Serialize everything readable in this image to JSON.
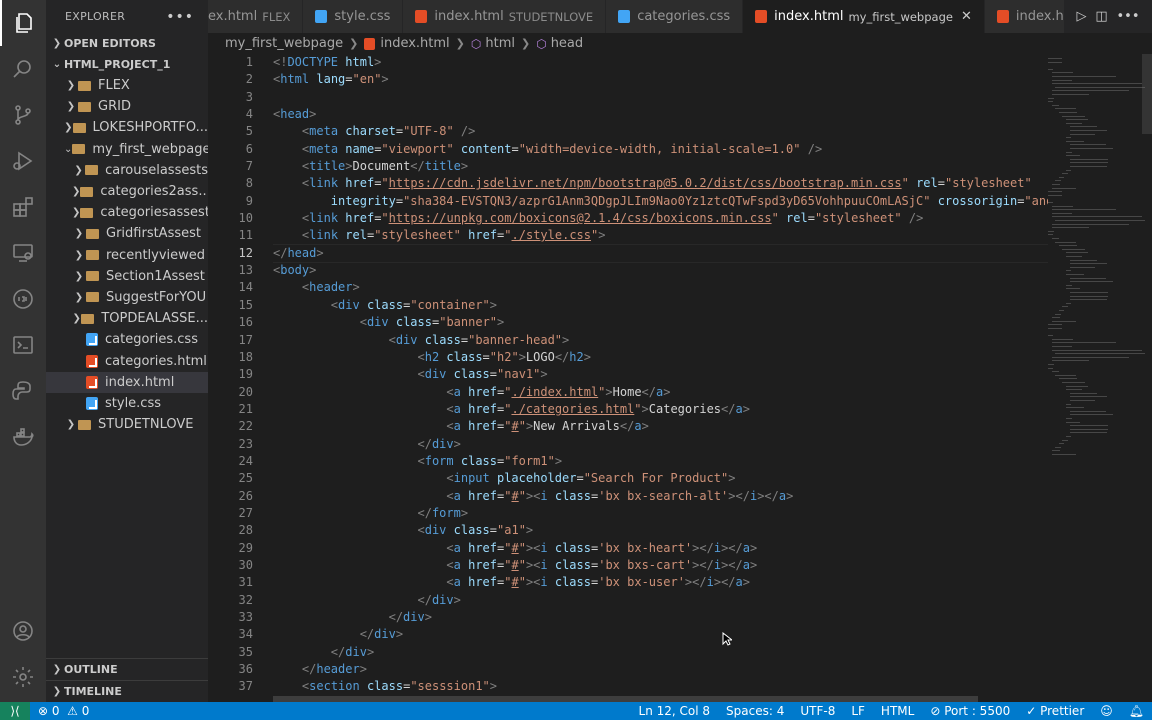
{
  "activity_bar": {
    "items": [
      {
        "name": "explorer-icon",
        "active": true
      },
      {
        "name": "search-icon"
      },
      {
        "name": "source-control-icon"
      },
      {
        "name": "run-debug-icon"
      },
      {
        "name": "extensions-icon"
      },
      {
        "name": "remote-explorer-icon"
      },
      {
        "name": "json-icon",
        "label": "Json"
      },
      {
        "name": "terminal-icon"
      },
      {
        "name": "python-icon"
      },
      {
        "name": "docker-icon"
      }
    ],
    "bottom": [
      {
        "name": "account-icon"
      },
      {
        "name": "settings-gear-icon"
      }
    ]
  },
  "sidebar": {
    "title": "EXPLORER",
    "more": "•••",
    "open_editors": "OPEN EDITORS",
    "project": "HTML_PROJECT_1",
    "tree": [
      {
        "label": "FLEX",
        "kind": "folder",
        "depth": 1
      },
      {
        "label": "GRID",
        "kind": "folder",
        "depth": 1
      },
      {
        "label": "LOKESHPORTFO...",
        "kind": "folder",
        "depth": 1
      },
      {
        "label": "my_first_webpage",
        "kind": "folder-open",
        "depth": 1
      },
      {
        "label": "carouselassests",
        "kind": "folder",
        "depth": 2
      },
      {
        "label": "categories2ass...",
        "kind": "folder",
        "depth": 2
      },
      {
        "label": "categoriesassest",
        "kind": "folder",
        "depth": 2
      },
      {
        "label": "GridfirstAssest",
        "kind": "folder",
        "depth": 2
      },
      {
        "label": "recentlyviewed",
        "kind": "folder",
        "depth": 2
      },
      {
        "label": "Section1Assest",
        "kind": "folder",
        "depth": 2
      },
      {
        "label": "SuggestForYOU",
        "kind": "folder",
        "depth": 2
      },
      {
        "label": "TOPDEALASSE...",
        "kind": "folder",
        "depth": 2
      },
      {
        "label": "categories.css",
        "kind": "css",
        "depth": 2
      },
      {
        "label": "categories.html",
        "kind": "html",
        "depth": 2
      },
      {
        "label": "index.html",
        "kind": "html",
        "depth": 2,
        "selected": true
      },
      {
        "label": "style.css",
        "kind": "css",
        "depth": 2
      },
      {
        "label": "STUDETNLOVE",
        "kind": "folder",
        "depth": 1
      }
    ],
    "outline": "OUTLINE",
    "timeline": "TIMELINE"
  },
  "tabs": [
    {
      "label": "ex.html",
      "desc": "FLEX",
      "kind": "none"
    },
    {
      "label": "style.css",
      "desc": "",
      "kind": "css"
    },
    {
      "label": "index.html",
      "desc": "STUDETNLOVE",
      "kind": "html"
    },
    {
      "label": "categories.css",
      "desc": "",
      "kind": "css"
    },
    {
      "label": "index.html",
      "desc": "my_first_webpage",
      "kind": "html",
      "active": true
    },
    {
      "label": "index.h",
      "desc": "",
      "kind": "html"
    }
  ],
  "tab_close": "✕",
  "breadcrumb": [
    "my_first_webpage",
    "index.html",
    "html",
    "head"
  ],
  "code_lines": [
    [
      [
        "pun",
        "<!"
      ],
      [
        "tag",
        "DOCTYPE"
      ],
      [
        "txt",
        " "
      ],
      [
        "attr",
        "html"
      ],
      [
        "pun",
        ">"
      ]
    ],
    [
      [
        "pun",
        "<"
      ],
      [
        "tag",
        "html"
      ],
      [
        "txt",
        " "
      ],
      [
        "attr",
        "lang"
      ],
      [
        "txt",
        "="
      ],
      [
        "str",
        "\"en\""
      ],
      [
        "pun",
        ">"
      ]
    ],
    [],
    [
      [
        "pun",
        "<"
      ],
      [
        "tag",
        "head"
      ],
      [
        "pun",
        ">"
      ]
    ],
    [
      [
        "txt",
        "    "
      ],
      [
        "pun",
        "<"
      ],
      [
        "tag",
        "meta"
      ],
      [
        "txt",
        " "
      ],
      [
        "attr",
        "charset"
      ],
      [
        "txt",
        "="
      ],
      [
        "str",
        "\"UTF-8\""
      ],
      [
        "txt",
        " "
      ],
      [
        "pun",
        "/>"
      ]
    ],
    [
      [
        "txt",
        "    "
      ],
      [
        "pun",
        "<"
      ],
      [
        "tag",
        "meta"
      ],
      [
        "txt",
        " "
      ],
      [
        "attr",
        "name"
      ],
      [
        "txt",
        "="
      ],
      [
        "str",
        "\"viewport\""
      ],
      [
        "txt",
        " "
      ],
      [
        "attr",
        "content"
      ],
      [
        "txt",
        "="
      ],
      [
        "str",
        "\"width=device-width, initial-scale=1.0\""
      ],
      [
        "txt",
        " "
      ],
      [
        "pun",
        "/>"
      ]
    ],
    [
      [
        "txt",
        "    "
      ],
      [
        "pun",
        "<"
      ],
      [
        "tag",
        "title"
      ],
      [
        "pun",
        ">"
      ],
      [
        "txt",
        "Document"
      ],
      [
        "pun",
        "</"
      ],
      [
        "tag",
        "title"
      ],
      [
        "pun",
        ">"
      ]
    ],
    [
      [
        "txt",
        "    "
      ],
      [
        "pun",
        "<"
      ],
      [
        "tag",
        "link"
      ],
      [
        "txt",
        " "
      ],
      [
        "attr",
        "href"
      ],
      [
        "txt",
        "="
      ],
      [
        "str",
        "\""
      ],
      [
        "link",
        "https://cdn.jsdelivr.net/npm/bootstrap@5.0.2/dist/css/bootstrap.min.css"
      ],
      [
        "str",
        "\""
      ],
      [
        "txt",
        " "
      ],
      [
        "attr",
        "rel"
      ],
      [
        "txt",
        "="
      ],
      [
        "str",
        "\"stylesheet\""
      ]
    ],
    [
      [
        "txt",
        "        "
      ],
      [
        "attr",
        "integrity"
      ],
      [
        "txt",
        "="
      ],
      [
        "str",
        "\"sha384-EVSTQN3/azprG1Anm3QDgpJLIm9Nao0Yz1ztcQTwFspd3yD65VohhpuuCOmLASjC\""
      ],
      [
        "txt",
        " "
      ],
      [
        "attr",
        "crossorigin"
      ],
      [
        "txt",
        "="
      ],
      [
        "str",
        "\"anonym"
      ]
    ],
    [
      [
        "txt",
        "    "
      ],
      [
        "pun",
        "<"
      ],
      [
        "tag",
        "link"
      ],
      [
        "txt",
        " "
      ],
      [
        "attr",
        "href"
      ],
      [
        "txt",
        "="
      ],
      [
        "str",
        "\""
      ],
      [
        "link",
        "https://unpkg.com/boxicons@2.1.4/css/boxicons.min.css"
      ],
      [
        "str",
        "\""
      ],
      [
        "txt",
        " "
      ],
      [
        "attr",
        "rel"
      ],
      [
        "txt",
        "="
      ],
      [
        "str",
        "\"stylesheet\""
      ],
      [
        "txt",
        " "
      ],
      [
        "pun",
        "/>"
      ]
    ],
    [
      [
        "txt",
        "    "
      ],
      [
        "pun",
        "<"
      ],
      [
        "tag",
        "link"
      ],
      [
        "txt",
        " "
      ],
      [
        "attr",
        "rel"
      ],
      [
        "txt",
        "="
      ],
      [
        "str",
        "\"stylesheet\""
      ],
      [
        "txt",
        " "
      ],
      [
        "attr",
        "href"
      ],
      [
        "txt",
        "="
      ],
      [
        "str",
        "\""
      ],
      [
        "link",
        "./style.css"
      ],
      [
        "str",
        "\""
      ],
      [
        "pun",
        ">"
      ]
    ],
    [
      [
        "pun",
        "</"
      ],
      [
        "tag",
        "head"
      ],
      [
        "pun",
        ">"
      ]
    ],
    [
      [
        "pun",
        "<"
      ],
      [
        "tag",
        "body"
      ],
      [
        "pun",
        ">"
      ]
    ],
    [
      [
        "txt",
        "    "
      ],
      [
        "pun",
        "<"
      ],
      [
        "tag",
        "header"
      ],
      [
        "pun",
        ">"
      ]
    ],
    [
      [
        "txt",
        "        "
      ],
      [
        "pun",
        "<"
      ],
      [
        "tag",
        "div"
      ],
      [
        "txt",
        " "
      ],
      [
        "attr",
        "class"
      ],
      [
        "txt",
        "="
      ],
      [
        "str",
        "\"container\""
      ],
      [
        "pun",
        ">"
      ]
    ],
    [
      [
        "txt",
        "            "
      ],
      [
        "pun",
        "<"
      ],
      [
        "tag",
        "div"
      ],
      [
        "txt",
        " "
      ],
      [
        "attr",
        "class"
      ],
      [
        "txt",
        "="
      ],
      [
        "str",
        "\"banner\""
      ],
      [
        "pun",
        ">"
      ]
    ],
    [
      [
        "txt",
        "                "
      ],
      [
        "pun",
        "<"
      ],
      [
        "tag",
        "div"
      ],
      [
        "txt",
        " "
      ],
      [
        "attr",
        "class"
      ],
      [
        "txt",
        "="
      ],
      [
        "str",
        "\"banner-head\""
      ],
      [
        "pun",
        ">"
      ]
    ],
    [
      [
        "txt",
        "                    "
      ],
      [
        "pun",
        "<"
      ],
      [
        "tag",
        "h2"
      ],
      [
        "txt",
        " "
      ],
      [
        "attr",
        "class"
      ],
      [
        "txt",
        "="
      ],
      [
        "str",
        "\"h2\""
      ],
      [
        "pun",
        ">"
      ],
      [
        "txt",
        "LOGO"
      ],
      [
        "pun",
        "</"
      ],
      [
        "tag",
        "h2"
      ],
      [
        "pun",
        ">"
      ]
    ],
    [
      [
        "txt",
        "                    "
      ],
      [
        "pun",
        "<"
      ],
      [
        "tag",
        "div"
      ],
      [
        "txt",
        " "
      ],
      [
        "attr",
        "class"
      ],
      [
        "txt",
        "="
      ],
      [
        "str",
        "\"nav1\""
      ],
      [
        "pun",
        ">"
      ]
    ],
    [
      [
        "txt",
        "                        "
      ],
      [
        "pun",
        "<"
      ],
      [
        "tag",
        "a"
      ],
      [
        "txt",
        " "
      ],
      [
        "attr",
        "href"
      ],
      [
        "txt",
        "="
      ],
      [
        "str",
        "\""
      ],
      [
        "link",
        "./index.html"
      ],
      [
        "str",
        "\""
      ],
      [
        "pun",
        ">"
      ],
      [
        "txt",
        "Home"
      ],
      [
        "pun",
        "</"
      ],
      [
        "tag",
        "a"
      ],
      [
        "pun",
        ">"
      ]
    ],
    [
      [
        "txt",
        "                        "
      ],
      [
        "pun",
        "<"
      ],
      [
        "tag",
        "a"
      ],
      [
        "txt",
        " "
      ],
      [
        "attr",
        "href"
      ],
      [
        "txt",
        "="
      ],
      [
        "str",
        "\""
      ],
      [
        "link",
        "./categories.html"
      ],
      [
        "str",
        "\""
      ],
      [
        "pun",
        ">"
      ],
      [
        "txt",
        "Categories"
      ],
      [
        "pun",
        "</"
      ],
      [
        "tag",
        "a"
      ],
      [
        "pun",
        ">"
      ]
    ],
    [
      [
        "txt",
        "                        "
      ],
      [
        "pun",
        "<"
      ],
      [
        "tag",
        "a"
      ],
      [
        "txt",
        " "
      ],
      [
        "attr",
        "href"
      ],
      [
        "txt",
        "="
      ],
      [
        "str",
        "\""
      ],
      [
        "link",
        "#"
      ],
      [
        "str",
        "\""
      ],
      [
        "pun",
        ">"
      ],
      [
        "txt",
        "New Arrivals"
      ],
      [
        "pun",
        "</"
      ],
      [
        "tag",
        "a"
      ],
      [
        "pun",
        ">"
      ]
    ],
    [
      [
        "txt",
        "                    "
      ],
      [
        "pun",
        "</"
      ],
      [
        "tag",
        "div"
      ],
      [
        "pun",
        ">"
      ]
    ],
    [
      [
        "txt",
        "                    "
      ],
      [
        "pun",
        "<"
      ],
      [
        "tag",
        "form"
      ],
      [
        "txt",
        " "
      ],
      [
        "attr",
        "class"
      ],
      [
        "txt",
        "="
      ],
      [
        "str",
        "\"form1\""
      ],
      [
        "pun",
        ">"
      ]
    ],
    [
      [
        "txt",
        "                        "
      ],
      [
        "pun",
        "<"
      ],
      [
        "tag",
        "input"
      ],
      [
        "txt",
        " "
      ],
      [
        "attr",
        "placeholder"
      ],
      [
        "txt",
        "="
      ],
      [
        "str",
        "\"Search For Product\""
      ],
      [
        "pun",
        ">"
      ]
    ],
    [
      [
        "txt",
        "                        "
      ],
      [
        "pun",
        "<"
      ],
      [
        "tag",
        "a"
      ],
      [
        "txt",
        " "
      ],
      [
        "attr",
        "href"
      ],
      [
        "txt",
        "="
      ],
      [
        "str",
        "\""
      ],
      [
        "link",
        "#"
      ],
      [
        "str",
        "\""
      ],
      [
        "pun",
        "><"
      ],
      [
        "tag",
        "i"
      ],
      [
        "txt",
        " "
      ],
      [
        "attr",
        "class"
      ],
      [
        "txt",
        "="
      ],
      [
        "str",
        "'bx bx-search-alt'"
      ],
      [
        "pun",
        "></"
      ],
      [
        "tag",
        "i"
      ],
      [
        "pun",
        "></"
      ],
      [
        "tag",
        "a"
      ],
      [
        "pun",
        ">"
      ]
    ],
    [
      [
        "txt",
        "                    "
      ],
      [
        "pun",
        "</"
      ],
      [
        "tag",
        "form"
      ],
      [
        "pun",
        ">"
      ]
    ],
    [
      [
        "txt",
        "                    "
      ],
      [
        "pun",
        "<"
      ],
      [
        "tag",
        "div"
      ],
      [
        "txt",
        " "
      ],
      [
        "attr",
        "class"
      ],
      [
        "txt",
        "="
      ],
      [
        "str",
        "\"a1\""
      ],
      [
        "pun",
        ">"
      ]
    ],
    [
      [
        "txt",
        "                        "
      ],
      [
        "pun",
        "<"
      ],
      [
        "tag",
        "a"
      ],
      [
        "txt",
        " "
      ],
      [
        "attr",
        "href"
      ],
      [
        "txt",
        "="
      ],
      [
        "str",
        "\""
      ],
      [
        "link",
        "#"
      ],
      [
        "str",
        "\""
      ],
      [
        "pun",
        "><"
      ],
      [
        "tag",
        "i"
      ],
      [
        "txt",
        " "
      ],
      [
        "attr",
        "class"
      ],
      [
        "txt",
        "="
      ],
      [
        "str",
        "'bx bx-heart'"
      ],
      [
        "pun",
        "></"
      ],
      [
        "tag",
        "i"
      ],
      [
        "pun",
        "></"
      ],
      [
        "tag",
        "a"
      ],
      [
        "pun",
        ">"
      ]
    ],
    [
      [
        "txt",
        "                        "
      ],
      [
        "pun",
        "<"
      ],
      [
        "tag",
        "a"
      ],
      [
        "txt",
        " "
      ],
      [
        "attr",
        "href"
      ],
      [
        "txt",
        "="
      ],
      [
        "str",
        "\""
      ],
      [
        "link",
        "#"
      ],
      [
        "str",
        "\""
      ],
      [
        "pun",
        "><"
      ],
      [
        "tag",
        "i"
      ],
      [
        "txt",
        " "
      ],
      [
        "attr",
        "class"
      ],
      [
        "txt",
        "="
      ],
      [
        "str",
        "'bx bxs-cart'"
      ],
      [
        "pun",
        "></"
      ],
      [
        "tag",
        "i"
      ],
      [
        "pun",
        "></"
      ],
      [
        "tag",
        "a"
      ],
      [
        "pun",
        ">"
      ]
    ],
    [
      [
        "txt",
        "                        "
      ],
      [
        "pun",
        "<"
      ],
      [
        "tag",
        "a"
      ],
      [
        "txt",
        " "
      ],
      [
        "attr",
        "href"
      ],
      [
        "txt",
        "="
      ],
      [
        "str",
        "\""
      ],
      [
        "link",
        "#"
      ],
      [
        "str",
        "\""
      ],
      [
        "pun",
        "><"
      ],
      [
        "tag",
        "i"
      ],
      [
        "txt",
        " "
      ],
      [
        "attr",
        "class"
      ],
      [
        "txt",
        "="
      ],
      [
        "str",
        "'bx bx-user'"
      ],
      [
        "pun",
        "></"
      ],
      [
        "tag",
        "i"
      ],
      [
        "pun",
        "></"
      ],
      [
        "tag",
        "a"
      ],
      [
        "pun",
        ">"
      ]
    ],
    [
      [
        "txt",
        "                    "
      ],
      [
        "pun",
        "</"
      ],
      [
        "tag",
        "div"
      ],
      [
        "pun",
        ">"
      ]
    ],
    [
      [
        "txt",
        "                "
      ],
      [
        "pun",
        "</"
      ],
      [
        "tag",
        "div"
      ],
      [
        "pun",
        ">"
      ]
    ],
    [
      [
        "txt",
        "            "
      ],
      [
        "pun",
        "</"
      ],
      [
        "tag",
        "div"
      ],
      [
        "pun",
        ">"
      ]
    ],
    [
      [
        "txt",
        "        "
      ],
      [
        "pun",
        "</"
      ],
      [
        "tag",
        "div"
      ],
      [
        "pun",
        ">"
      ]
    ],
    [
      [
        "txt",
        "    "
      ],
      [
        "pun",
        "</"
      ],
      [
        "tag",
        "header"
      ],
      [
        "pun",
        ">"
      ]
    ],
    [
      [
        "txt",
        "    "
      ],
      [
        "pun",
        "<"
      ],
      [
        "tag",
        "section"
      ],
      [
        "txt",
        " "
      ],
      [
        "attr",
        "class"
      ],
      [
        "txt",
        "="
      ],
      [
        "str",
        "\"sesssion1\""
      ],
      [
        "pun",
        ">"
      ]
    ]
  ],
  "current_line": 12,
  "status": {
    "remote_icon": "remote-icon",
    "errors": "0",
    "warnings": "0",
    "position": "Ln 12, Col 8",
    "spaces": "Spaces: 4",
    "encoding": "UTF-8",
    "eol": "LF",
    "language": "HTML",
    "port": "Port : 5500",
    "prettier": "Prettier"
  },
  "colors": {
    "statusbar": "#007acc",
    "editor_bg": "#1e1e1e",
    "sidebar_bg": "#252526",
    "activity_bg": "#333333"
  }
}
